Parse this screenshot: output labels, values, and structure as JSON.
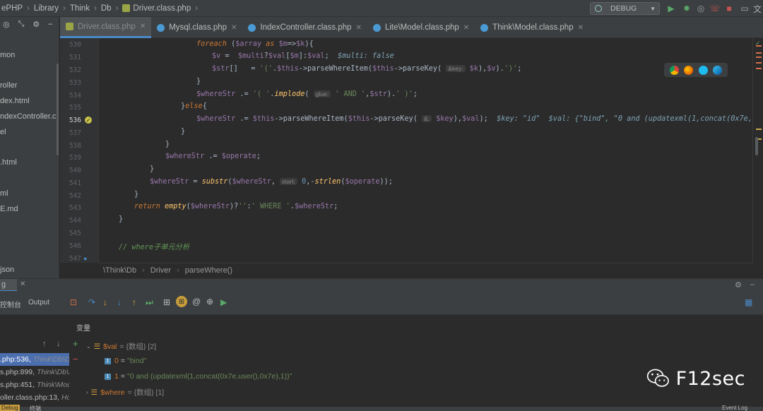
{
  "breadcrumb": [
    "ePHP",
    "Library",
    "Think",
    "Db",
    "Driver.class.php"
  ],
  "run_config": {
    "label": "DEBUG"
  },
  "project": {
    "items": [
      "mon",
      "roller",
      "dex.html",
      "ndexController.class",
      "el",
      ".html",
      "ml",
      "E.md",
      "json"
    ]
  },
  "tabs": [
    {
      "label": "Driver.class.php",
      "active": true
    },
    {
      "label": "Mysql.class.php"
    },
    {
      "label": "IndexController.class.php"
    },
    {
      "label": "Lite\\Model.class.php"
    },
    {
      "label": "Think\\Model.class.php"
    }
  ],
  "editor": {
    "line_numbers": [
      "530",
      "531",
      "532",
      "533",
      "534",
      "535",
      "536",
      "537",
      "538",
      "539",
      "540",
      "541",
      "542",
      "543",
      "544",
      "545",
      "546",
      "547"
    ],
    "current_line": "536",
    "hints": {
      "multi_false": "$multi: false",
      "key_param": "&key:",
      "glue_param": "glue:",
      "start_param": "start:",
      "key_param2": "&:"
    },
    "inline_debug": "$key: \"id\"  $val: {\"bind\", \"0 and (updatexml(1,concat(0x7e,user(),0x7e),",
    "comment_546": "// where子单元分析"
  },
  "code_crumb": [
    "\\Think\\Db",
    "Driver",
    "parseWhere()"
  ],
  "debug": {
    "tab_label": "g",
    "console_label": "控制台",
    "output_label": "Output",
    "variables_title": "变量",
    "frames": [
      {
        "file": ".php:536, ",
        "cls": "Think\\Db\\D",
        "selected": true
      },
      {
        "file": "s.php:899, ",
        "cls": "Think\\Db\\D"
      },
      {
        "file": "s.php:451, ",
        "cls": "Think\\Mod"
      },
      {
        "file": "oller.class.php:13, ",
        "cls": "Ho"
      }
    ],
    "vars": {
      "val_name": "$val",
      "val_type": "= {数组} [2]",
      "items": [
        {
          "key": "0",
          "value": "\"bind\""
        },
        {
          "key": "1",
          "value": "\"0 and (updatexml(1,concat(0x7e,user(),0x7e),1))\""
        }
      ],
      "where_name": "$where",
      "where_type": "= {数组} [1]"
    },
    "footer_left": "Debug",
    "footer_left2": "终端",
    "footer_right": "Event Log"
  },
  "watermark": "F12sec",
  "colors": {
    "accent": "#4a88c7",
    "highlight": "#2d6b34",
    "selection": "#4b6eaf"
  }
}
